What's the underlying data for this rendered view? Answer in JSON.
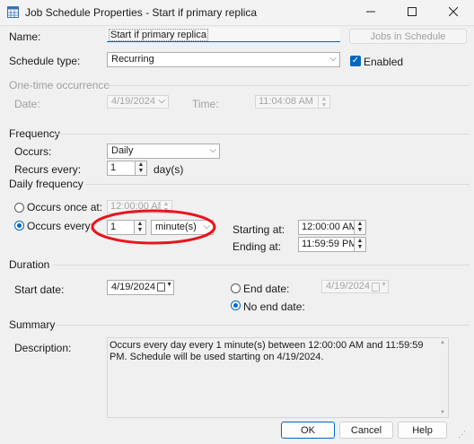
{
  "window": {
    "title": "Job Schedule Properties - Start if primary replica",
    "icons": [
      "app-icon",
      "minimize-icon",
      "maximize-icon",
      "close-icon"
    ]
  },
  "name": {
    "label": "Name:",
    "value": "Start if primary replica",
    "jobs_button": "Jobs in Schedule"
  },
  "schedule_type": {
    "label": "Schedule type:",
    "value": "Recurring",
    "enabled_label": "Enabled",
    "enabled": true
  },
  "one_time": {
    "header": "One-time occurrence",
    "date_label": "Date:",
    "date_value": "4/19/2024",
    "time_label": "Time:",
    "time_value": "11:04:08 AM"
  },
  "frequency": {
    "header": "Frequency",
    "occurs_label": "Occurs:",
    "occurs_value": "Daily",
    "recurs_label": "Recurs every:",
    "recurs_value": "1",
    "recurs_unit": "day(s)"
  },
  "daily_frequency": {
    "header": "Daily frequency",
    "once_label": "Occurs once at:",
    "once_value": "12:00:00 AM",
    "every_label": "Occurs every:",
    "every_value": "1",
    "every_unit": "minute(s)",
    "starting_label": "Starting at:",
    "starting_value": "12:00:00 AM",
    "ending_label": "Ending at:",
    "ending_value": "11:59:59 PM",
    "selected": "every"
  },
  "duration": {
    "header": "Duration",
    "start_label": "Start date:",
    "start_value": "4/19/2024",
    "end_label": "End date:",
    "end_value": "4/19/2024",
    "no_end_label": "No end date:",
    "selected": "no_end"
  },
  "summary": {
    "header": "Summary",
    "description_label": "Description:",
    "description_text": "Occurs every day every 1 minute(s) between 12:00:00 AM and 11:59:59 PM. Schedule will be used starting on 4/19/2024."
  },
  "footer": {
    "ok": "OK",
    "cancel": "Cancel",
    "help": "Help"
  },
  "colors": {
    "accent": "#0067c0",
    "annotation": "#e8141c",
    "background": "#f0f0f0"
  }
}
